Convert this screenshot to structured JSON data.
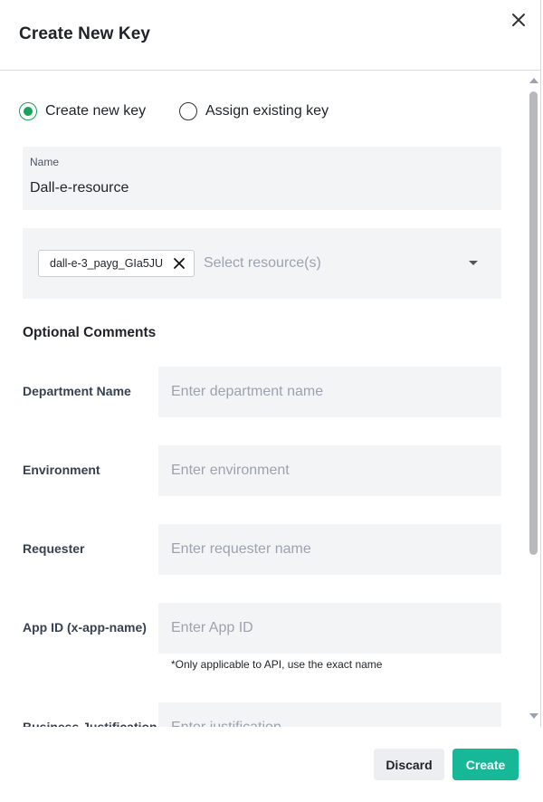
{
  "dialog": {
    "title": "Create New Key",
    "close_icon": "close-icon"
  },
  "key_mode": {
    "options": [
      {
        "label": "Create new key",
        "selected": true
      },
      {
        "label": "Assign existing key",
        "selected": false
      }
    ],
    "accent_color": "#19a35a"
  },
  "name_field": {
    "label": "Name",
    "value": "Dall-e-resource"
  },
  "resource_select": {
    "selected_chips": [
      {
        "label": "dall-e-3_payg_GIa5JU"
      }
    ],
    "placeholder": "Select resource(s)",
    "chip_remove_icon": "close-icon",
    "dropdown_icon": "caret-down-icon"
  },
  "optional_comments": {
    "title": "Optional Comments",
    "fields": [
      {
        "label": "Department Name",
        "placeholder": "Enter department name",
        "value": ""
      },
      {
        "label": "Environment",
        "placeholder": "Enter environment",
        "value": ""
      },
      {
        "label": "Requester",
        "placeholder": "Enter requester name",
        "value": ""
      },
      {
        "label": "App ID (x-app-name)",
        "placeholder": "Enter App ID",
        "value": "",
        "helper": "*Only applicable to API, use the exact name"
      },
      {
        "label": "Business Justification",
        "placeholder": "Enter justification",
        "value": ""
      }
    ]
  },
  "footer": {
    "discard_label": "Discard",
    "create_label": "Create",
    "create_color": "#17b897"
  }
}
